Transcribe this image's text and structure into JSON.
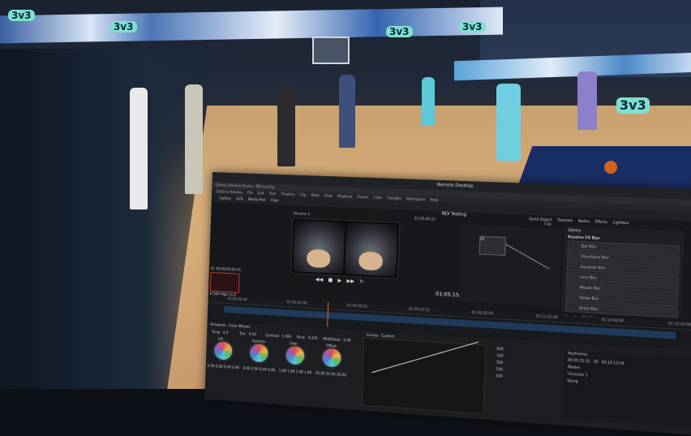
{
  "remote_desktop": {
    "title": "Remote Desktop"
  },
  "app": {
    "title": "DaVinci Resolve Studio - NDI testing"
  },
  "menu": [
    "DaVinci Resolve",
    "File",
    "Edit",
    "Trim",
    "Timeline",
    "Clip",
    "Mark",
    "View",
    "Playback",
    "Fusion",
    "Color",
    "Fairlight",
    "Workspace",
    "Help"
  ],
  "toolbar": {
    "gallery": "Gallery",
    "luts": "LUTs",
    "media_pool": "Media Pool",
    "clips": "Clips"
  },
  "project": {
    "name": "NDI Testing"
  },
  "viewer": {
    "timeline_name": "Timeline 2",
    "timecode_small": "01:05:09:22",
    "zoom": "Clip",
    "timecode": "01:05:15:22"
  },
  "right_tabs": [
    "Quick Export",
    "Timeline",
    "Nodes",
    "Effects",
    "Lightbox"
  ],
  "library": {
    "tab": "Library",
    "header": "Resolve FX Blur",
    "items": [
      "Box Blur",
      "Directional Blur",
      "Gaussian Blur",
      "Lens Blur",
      "Mosaic Blur",
      "Radial Blur",
      "Zoom Blur"
    ],
    "footer": "Resolve FX Color"
  },
  "clip": {
    "meta": "01  00:00:00:00  V1",
    "name": "H.264 High L5.0"
  },
  "timeline_ruler": [
    "01:05:00:00",
    "01:05:05:00",
    "01:05:09:22",
    "01:05:15:22",
    "01:05:20:00",
    "01:11:22:00",
    "01:10:00:00",
    "01:15:10:00"
  ],
  "color": {
    "primaries_label": "Primaries - Color Wheels",
    "temp_label": "Temp",
    "temp": "0.0",
    "tint_label": "Tint",
    "tint": "0.00",
    "contrast_label": "Contrast",
    "contrast": "1.000",
    "pivot_label": "Pivot",
    "pivot": "0.435",
    "middetail_label": "Mid/Detail",
    "middetail": "0.00",
    "wheels": [
      {
        "name": "Lift",
        "values": "0.00  0.00  0.00  0.00"
      },
      {
        "name": "Gamma",
        "values": "0.00  0.00  0.00  0.00"
      },
      {
        "name": "Gain",
        "values": "1.00  1.00  1.00  1.00"
      },
      {
        "name": "Offset",
        "values": "25.00  25.00  25.00"
      }
    ],
    "curves_label": "Curves - Custom",
    "edit_label": "Edit",
    "edit_values": [
      "100",
      "100",
      "100",
      "100"
    ],
    "keyframes_label": "Keyframes",
    "kf_all": "All",
    "kf_timecode": "00:05:15:22",
    "kf_end": "00:12:13:19",
    "kf_rows": [
      "Master",
      "Corrector 1",
      "Sizing"
    ]
  }
}
